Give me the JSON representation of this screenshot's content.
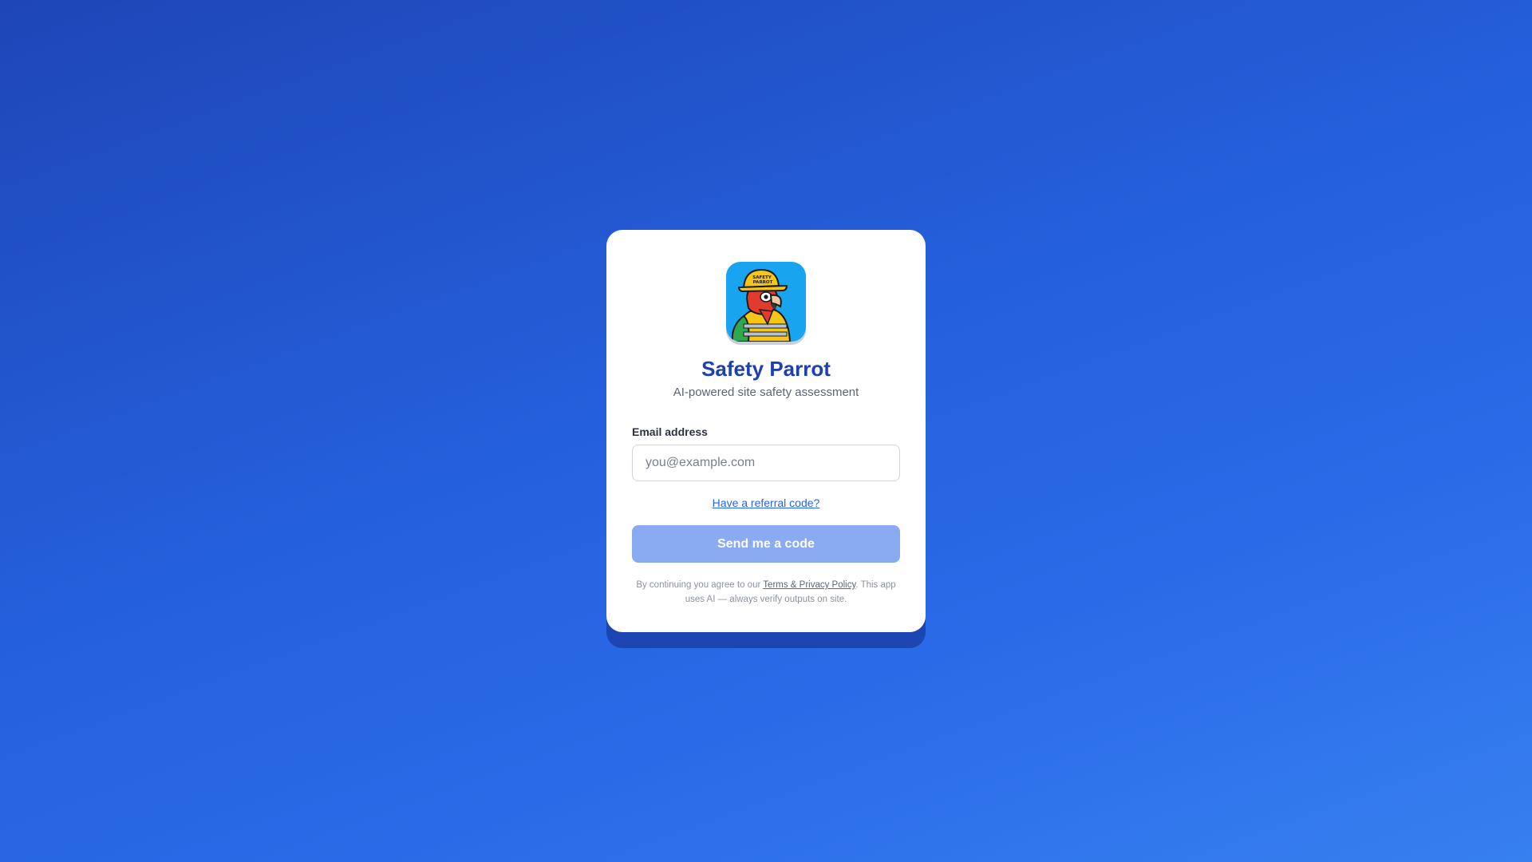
{
  "app": {
    "title": "Safety Parrot",
    "subtitle": "AI-powered site safety assessment",
    "logo_icon": "parrot-hardhat-logo",
    "logo_hat_text": "SAFETY PARROT"
  },
  "form": {
    "email_label": "Email address",
    "email_placeholder": "you@example.com",
    "email_value": "",
    "referral_link": "Have a referral code?",
    "submit_label": "Send me a code"
  },
  "legal": {
    "prefix": "By continuing you agree to our ",
    "link_label": "Terms & Privacy Policy",
    "suffix": ". This app uses AI — always verify outputs on site."
  },
  "colors": {
    "background_start": "#1e46b8",
    "background_end": "#3780f0",
    "accent": "#1e40af",
    "link": "#2563eb",
    "button_disabled": "#8aaaf2",
    "logo_bg": "#18a4ee"
  }
}
